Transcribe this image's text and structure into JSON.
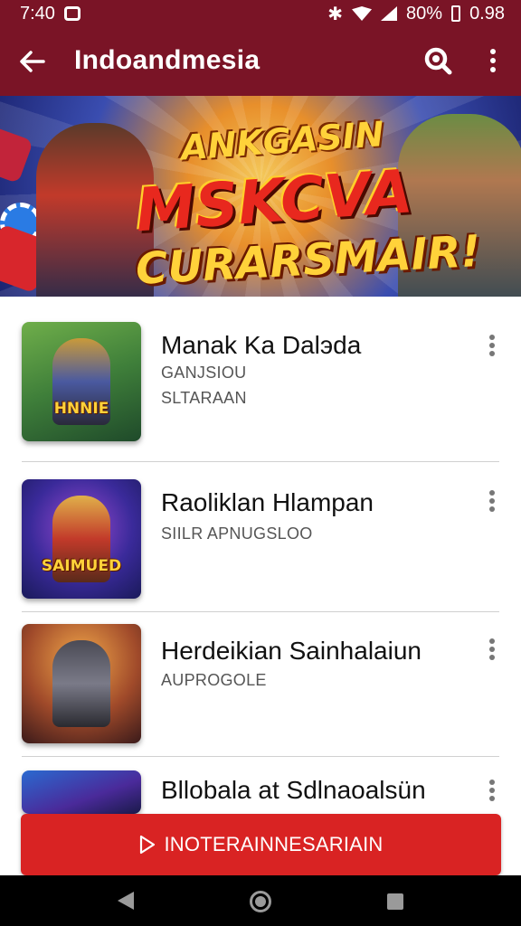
{
  "status_bar": {
    "time": "7:40",
    "battery": "80%",
    "clock_right": "0.98",
    "icons": [
      "notification-square-icon",
      "bluetooth-icon",
      "wifi-icon",
      "signal-icon",
      "battery-icon"
    ]
  },
  "app_bar": {
    "title": "Indoandmesia",
    "icons": [
      "back-arrow-icon",
      "search-icon",
      "more-vert-icon"
    ]
  },
  "banner": {
    "line1": "ANKGASIN",
    "line2": "MSKCVA",
    "line3": "CURARSMAIR!"
  },
  "games": [
    {
      "title": "Manak Ka Dalэda",
      "sub1": "GANJSIOU",
      "sub2": "SLTARAAN",
      "thumb_caption": "HNNIE"
    },
    {
      "title": "Raoliklan Hlampan",
      "sub1": "SIILR APNUGSLOO",
      "sub2": "",
      "thumb_caption": "SAIMUED"
    },
    {
      "title": "Herdeikian Sainhalaiun",
      "sub1": "AUPROGOLE",
      "sub2": "",
      "thumb_caption": ""
    },
    {
      "title": "Bllobala at Sdlnaoalsün",
      "sub1": "",
      "sub2": "",
      "thumb_caption": ""
    }
  ],
  "cta": {
    "label": "INOTERAINNESARIAIN",
    "icon": "play-outline-icon"
  },
  "colors": {
    "app_bar": "#7a1426",
    "cta": "#d92323"
  }
}
